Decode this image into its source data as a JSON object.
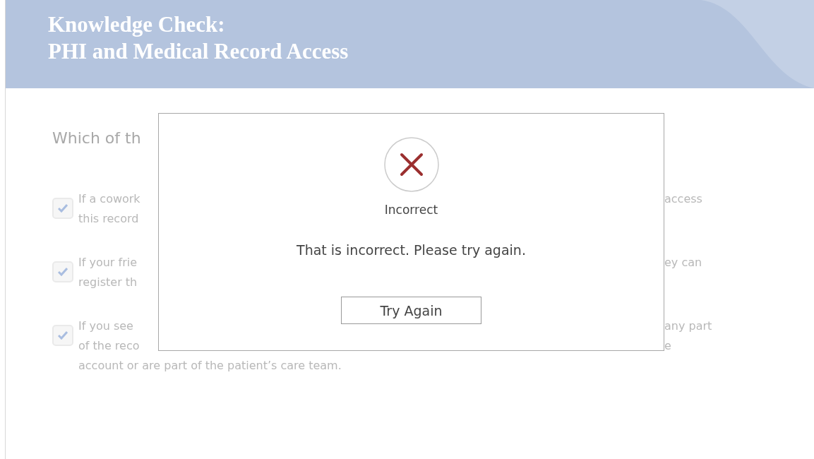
{
  "header": {
    "title_lines": [
      "Knowledge Check:",
      "PHI and Medical Record Access"
    ]
  },
  "question": {
    "text": "Which of th"
  },
  "options": [
    {
      "checked": true,
      "left_lines": [
        "If a cowork",
        "this record"
      ],
      "right_lines": [
        "access"
      ]
    },
    {
      "checked": true,
      "left_lines": [
        "If your frie",
        "register th"
      ],
      "right_lines": [
        "ey can"
      ]
    },
    {
      "checked": true,
      "left_lines": [
        "If you see",
        "of the reco"
      ],
      "right_lines": [
        "any part",
        "e"
      ],
      "full_lines": [
        "account or are part of the patient’s care team."
      ]
    }
  ],
  "dialog": {
    "correct": false,
    "title": "Incorrect",
    "message": "That is incorrect. Please try again.",
    "button": "Try Again"
  }
}
